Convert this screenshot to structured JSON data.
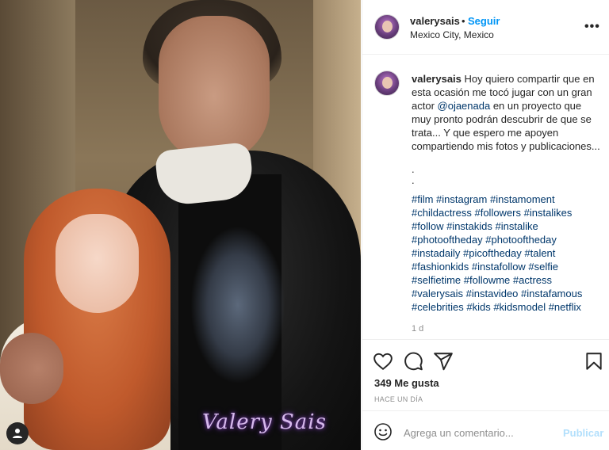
{
  "post": {
    "username": "valerysais",
    "dot": "•",
    "follow_label": "Seguir",
    "location": "Mexico City, Mexico",
    "more_icon": "more-horizontal-icon",
    "watermark": "Valery Sais"
  },
  "caption": {
    "username": "valerysais",
    "text_before_mention": "Hoy quiero compartir que en esta ocasión me tocó jugar con un gran actor ",
    "mention": "@ojaenada",
    "text_after_mention": " en un proyecto que muy pronto podrán descubrir de que se trata... Y que espero me apoyen compartiendo mis fotos y publicaciones...",
    "dot1": ".",
    "dot2": ".",
    "hashtags": "#film #instagram #instamoment #childactress #followers #instalikes #follow #instakids #instalike #photooftheday #photooftheday #instadaily #picoftheday #talent #fashionkids #instafollow #selfie #selfietime #followme #actress #valerysais #instavideo #instafamous #celebrities #kids #kidsmodel #netflix",
    "time_ago": "1 d"
  },
  "actions": {
    "icons": [
      "heart-icon",
      "comment-icon",
      "share-icon",
      "bookmark-icon"
    ],
    "likes": "349 Me gusta",
    "posted": "HACE UN DÍA"
  },
  "comment": {
    "placeholder": "Agrega un comentario...",
    "post_label": "Publicar",
    "emoji_icon": "emoji-icon"
  },
  "colors": {
    "link_blue": "#0095f6",
    "hashtag_blue": "#00376b",
    "muted": "#8e8e8e",
    "post_disabled": "#b2dffc"
  }
}
